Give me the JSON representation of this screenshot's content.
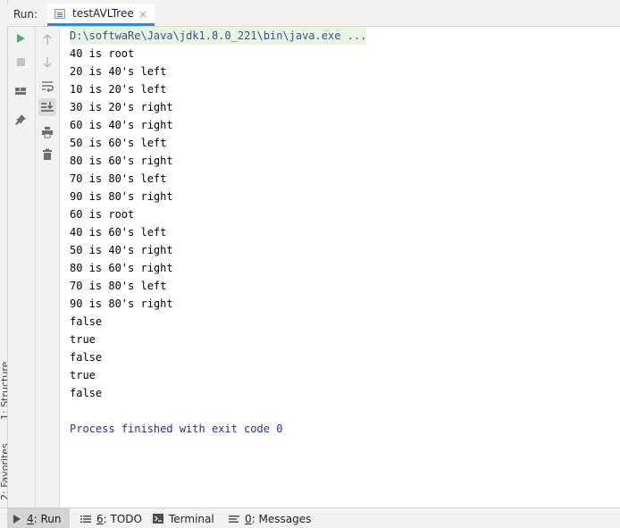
{
  "run_header": {
    "label": "Run:",
    "tab_label": "testAVLTree",
    "tab_close": "×"
  },
  "side_labels": {
    "structure": "1: Structure",
    "favorites": "2: Favorites"
  },
  "toolbar": {
    "col1": [
      "run-icon",
      "stop-icon",
      "layout-icon",
      "pin-icon"
    ],
    "col2": [
      "arrow-up-icon",
      "arrow-down-icon",
      "soft-wrap-icon",
      "scroll-to-end-icon",
      "print-icon",
      "trash-icon"
    ]
  },
  "console": {
    "command": "D:\\softwaRe\\Java\\jdk1.8.0_221\\bin\\java.exe ...",
    "lines": [
      "40 is root",
      "20 is 40's left",
      "10 is 20's left",
      "30 is 20's right",
      "60 is 40's right",
      "50 is 60's left",
      "80 is 60's right",
      "70 is 80's left",
      "90 is 80's right",
      "60 is root",
      "40 is 60's left",
      "50 is 40's right",
      "80 is 60's right",
      "70 is 80's left",
      "90 is 80's right",
      "false",
      "true",
      "false",
      "true",
      "false"
    ],
    "process_message": "Process finished with exit code 0"
  },
  "bottom_tabs": {
    "run": {
      "num": "4",
      "rest": ": Run"
    },
    "todo": {
      "num": "6",
      "rest": ": TODO"
    },
    "terminal": {
      "label": "Terminal"
    },
    "messages": {
      "num": "0",
      "rest": ": Messages"
    }
  },
  "colors": {
    "run_green": "#59a869",
    "tab_underline": "#4083c9",
    "command_bg": "#eaf5e1",
    "command_text": "#3b4c9c",
    "process_text": "#1f2bb0"
  }
}
